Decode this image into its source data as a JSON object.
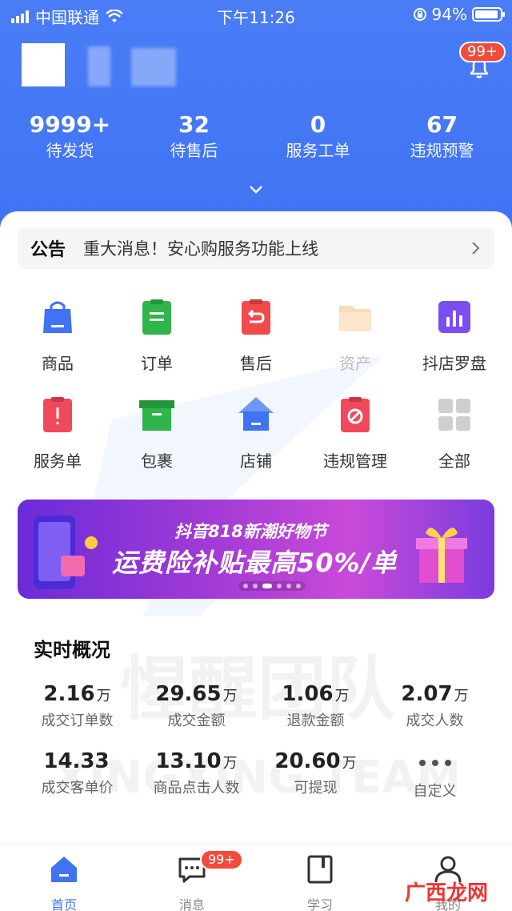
{
  "status_bar": {
    "carrier": "中国联通",
    "time": "下午11:26",
    "battery": "94%",
    "battery_fraction": 0.94
  },
  "header": {
    "notification_badge": "99+",
    "stats": [
      {
        "value": "9999+",
        "label": "待发货"
      },
      {
        "value": "32",
        "label": "待售后"
      },
      {
        "value": "0",
        "label": "服务工单"
      },
      {
        "value": "67",
        "label": "违规预警"
      }
    ]
  },
  "notice": {
    "tag": "公告",
    "text": "重大消息！安心购服务功能上线"
  },
  "grid": [
    {
      "label": "商品",
      "icon": "bag-icon",
      "color": "#3f73f4"
    },
    {
      "label": "订单",
      "icon": "clipboard-icon",
      "color": "#2fb54a"
    },
    {
      "label": "售后",
      "icon": "return-icon",
      "color": "#f04a4a"
    },
    {
      "label": "资产",
      "icon": "folder-icon",
      "color": "#f8dcb8",
      "dim": true
    },
    {
      "label": "抖店罗盘",
      "icon": "chart-icon",
      "color": "#7a4ef0"
    },
    {
      "label": "服务单",
      "icon": "alert-doc-icon",
      "color": "#f04a5a"
    },
    {
      "label": "包裹",
      "icon": "box-icon",
      "color": "#2fb54a"
    },
    {
      "label": "店铺",
      "icon": "store-icon",
      "color": "#3f73f4"
    },
    {
      "label": "违规管理",
      "icon": "ban-icon",
      "color": "#f04a5a"
    },
    {
      "label": "全部",
      "icon": "grid-icon",
      "color": "#cfcfcf"
    }
  ],
  "banner": {
    "subtitle": "抖音818新潮好物节",
    "title": "运费险补贴最高50%/单"
  },
  "overview": {
    "title": "实时概况",
    "metrics": [
      {
        "value": "2.16",
        "unit": "万",
        "label": "成交订单数"
      },
      {
        "value": "29.65",
        "unit": "万",
        "label": "成交金额"
      },
      {
        "value": "1.06",
        "unit": "万",
        "label": "退款金额"
      },
      {
        "value": "2.07",
        "unit": "万",
        "label": "成交人数"
      },
      {
        "value": "14.33",
        "unit": "",
        "label": "成交客单价"
      },
      {
        "value": "13.10",
        "unit": "万",
        "label": "商品点击人数"
      },
      {
        "value": "20.60",
        "unit": "万",
        "label": "可提现"
      },
      {
        "value": "",
        "unit": "",
        "label": "自定义"
      }
    ]
  },
  "watermark": {
    "cn": "惺醒团队",
    "en": "XINGXING TEAM"
  },
  "tabbar": {
    "tabs": [
      {
        "label": "首页"
      },
      {
        "label": "消息",
        "badge": "99+"
      },
      {
        "label": "学习"
      },
      {
        "label": "我的"
      }
    ],
    "site_mark": "广西龙网"
  }
}
